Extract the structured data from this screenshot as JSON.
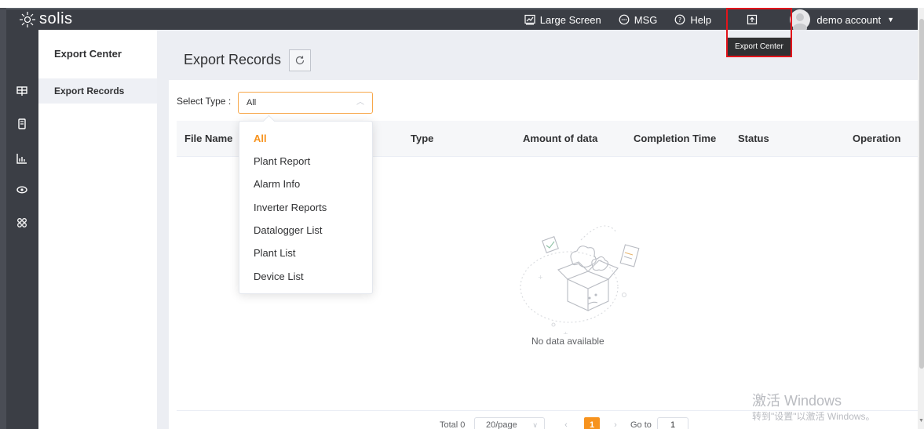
{
  "brand": {
    "logo_text": "solis"
  },
  "topnav": {
    "large_screen": "Large Screen",
    "msg": "MSG",
    "help": "Help",
    "account": "demo account"
  },
  "tooltip": {
    "text": "Export Center"
  },
  "subnav": {
    "title": "Export Center",
    "items": [
      {
        "label": "Export Records"
      }
    ]
  },
  "page": {
    "title": "Export Records"
  },
  "filter": {
    "label": "Select Type :",
    "value": "All"
  },
  "dropdown": {
    "options": [
      "All",
      "Plant Report",
      "Alarm Info",
      "Inverter Reports",
      "Datalogger List",
      "Plant List",
      "Device List"
    ],
    "selected": "All"
  },
  "table": {
    "columns": [
      "File Name",
      "Type",
      "Amount of data",
      "Completion Time",
      "Status",
      "Operation"
    ],
    "empty_text": "No data available"
  },
  "pagination": {
    "total": "Total 0",
    "page_size": "20/page",
    "current_page": "1",
    "goto_label": "Go to",
    "goto_value": "1"
  },
  "watermark": {
    "line1": "激活 Windows",
    "line2": "转到\"设置\"以激活 Windows。"
  },
  "colors": {
    "accent": "#f7931e",
    "topbar": "#3b3e45",
    "highlight": "#e3141b"
  }
}
